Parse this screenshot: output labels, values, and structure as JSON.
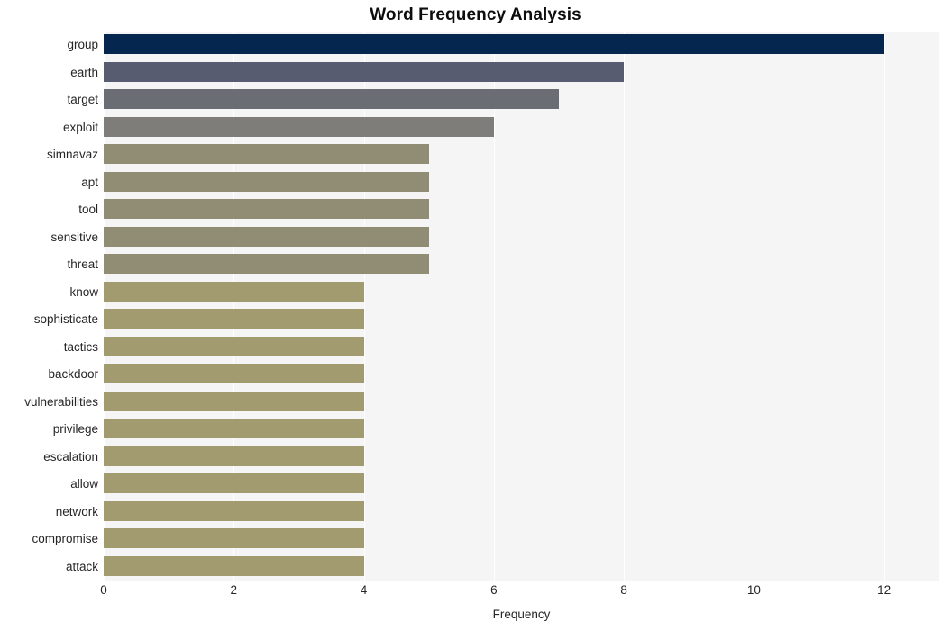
{
  "chart_data": {
    "type": "bar",
    "orientation": "horizontal",
    "title": "Word Frequency Analysis",
    "xlabel": "Frequency",
    "ylabel": "",
    "xlim": [
      0,
      12.85
    ],
    "xticks": [
      0,
      2,
      4,
      6,
      8,
      10,
      12
    ],
    "xtick_labels": [
      "0",
      "2",
      "4",
      "6",
      "8",
      "10",
      "12"
    ],
    "grid": "vertical-only",
    "legend": "none",
    "plot_background": "#f5f5f6",
    "figure_background": "#ffffff",
    "gridline_color": "#ffffff",
    "categories": [
      "group",
      "earth",
      "target",
      "exploit",
      "simnavaz",
      "apt",
      "tool",
      "sensitive",
      "threat",
      "know",
      "sophisticate",
      "tactics",
      "backdoor",
      "vulnerabilities",
      "privilege",
      "escalation",
      "allow",
      "network",
      "compromise",
      "attack"
    ],
    "values": [
      12,
      8,
      7,
      6,
      5,
      5,
      5,
      5,
      5,
      4,
      4,
      4,
      4,
      4,
      4,
      4,
      4,
      4,
      4,
      4
    ],
    "bar_colors": [
      "#04264f",
      "#575c70",
      "#6b6d75",
      "#7e7d7a",
      "#918c74",
      "#918c74",
      "#918c74",
      "#918c74",
      "#918c74",
      "#a39b70",
      "#a39b70",
      "#a39b70",
      "#a39b70",
      "#a39b70",
      "#a39b70",
      "#a39b70",
      "#a39b70",
      "#a39b70",
      "#a39b70",
      "#a39b70"
    ]
  }
}
